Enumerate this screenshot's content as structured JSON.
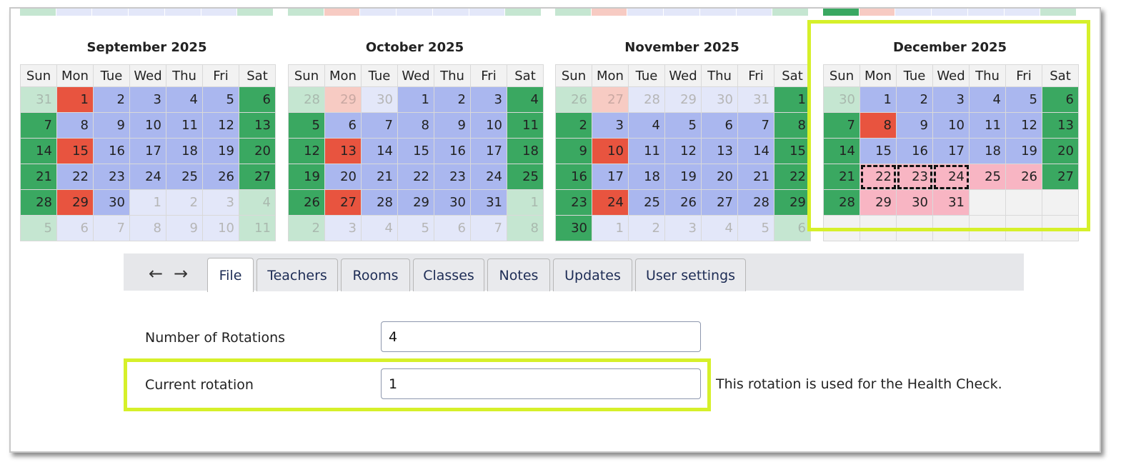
{
  "weekdays": [
    "Sun",
    "Mon",
    "Tue",
    "Wed",
    "Thu",
    "Fri",
    "Sat"
  ],
  "months": [
    {
      "title": "September 2025",
      "prev_strip": [
        "c-lgreen",
        "c-lblue",
        "c-lblue",
        "c-lblue",
        "c-lblue",
        "c-lblue",
        "c-lgreen"
      ],
      "weeks": [
        [
          [
            "31",
            "lgreen"
          ],
          [
            "1",
            "red"
          ],
          [
            "2",
            "blue"
          ],
          [
            "3",
            "blue"
          ],
          [
            "4",
            "blue"
          ],
          [
            "5",
            "blue"
          ],
          [
            "6",
            "green"
          ]
        ],
        [
          [
            "7",
            "green"
          ],
          [
            "8",
            "blue"
          ],
          [
            "9",
            "blue"
          ],
          [
            "10",
            "blue"
          ],
          [
            "11",
            "blue"
          ],
          [
            "12",
            "blue"
          ],
          [
            "13",
            "green"
          ]
        ],
        [
          [
            "14",
            "green"
          ],
          [
            "15",
            "red"
          ],
          [
            "16",
            "blue"
          ],
          [
            "17",
            "blue"
          ],
          [
            "18",
            "blue"
          ],
          [
            "19",
            "blue"
          ],
          [
            "20",
            "green"
          ]
        ],
        [
          [
            "21",
            "green"
          ],
          [
            "22",
            "blue"
          ],
          [
            "23",
            "blue"
          ],
          [
            "24",
            "blue"
          ],
          [
            "25",
            "blue"
          ],
          [
            "26",
            "blue"
          ],
          [
            "27",
            "green"
          ]
        ],
        [
          [
            "28",
            "green"
          ],
          [
            "29",
            "red"
          ],
          [
            "30",
            "blue"
          ],
          [
            "1",
            "lblue"
          ],
          [
            "2",
            "lblue"
          ],
          [
            "3",
            "lblue"
          ],
          [
            "4",
            "lgreen"
          ]
        ],
        [
          [
            "5",
            "lgreen"
          ],
          [
            "6",
            "lblue"
          ],
          [
            "7",
            "lblue"
          ],
          [
            "8",
            "lblue"
          ],
          [
            "9",
            "lblue"
          ],
          [
            "10",
            "lblue"
          ],
          [
            "11",
            "lgreen"
          ]
        ]
      ]
    },
    {
      "title": "October 2025",
      "prev_strip": [
        "c-lgreen",
        "c-lred",
        "c-lblue",
        "c-lblue",
        "c-lblue",
        "c-lblue",
        "c-lgreen"
      ],
      "weeks": [
        [
          [
            "28",
            "lgreen"
          ],
          [
            "29",
            "lred"
          ],
          [
            "30",
            "lblue"
          ],
          [
            "1",
            "blue"
          ],
          [
            "2",
            "blue"
          ],
          [
            "3",
            "blue"
          ],
          [
            "4",
            "green"
          ]
        ],
        [
          [
            "5",
            "green"
          ],
          [
            "6",
            "blue"
          ],
          [
            "7",
            "blue"
          ],
          [
            "8",
            "blue"
          ],
          [
            "9",
            "blue"
          ],
          [
            "10",
            "blue"
          ],
          [
            "11",
            "green"
          ]
        ],
        [
          [
            "12",
            "green"
          ],
          [
            "13",
            "red"
          ],
          [
            "14",
            "blue"
          ],
          [
            "15",
            "blue"
          ],
          [
            "16",
            "blue"
          ],
          [
            "17",
            "blue"
          ],
          [
            "18",
            "green"
          ]
        ],
        [
          [
            "19",
            "green"
          ],
          [
            "20",
            "blue"
          ],
          [
            "21",
            "blue"
          ],
          [
            "22",
            "blue"
          ],
          [
            "23",
            "blue"
          ],
          [
            "24",
            "blue"
          ],
          [
            "25",
            "green"
          ]
        ],
        [
          [
            "26",
            "green"
          ],
          [
            "27",
            "red"
          ],
          [
            "28",
            "blue"
          ],
          [
            "29",
            "blue"
          ],
          [
            "30",
            "blue"
          ],
          [
            "31",
            "blue"
          ],
          [
            "1",
            "lgreen"
          ]
        ],
        [
          [
            "2",
            "lgreen"
          ],
          [
            "3",
            "lblue"
          ],
          [
            "4",
            "lblue"
          ],
          [
            "5",
            "lblue"
          ],
          [
            "6",
            "lblue"
          ],
          [
            "7",
            "lblue"
          ],
          [
            "8",
            "lgreen"
          ]
        ]
      ]
    },
    {
      "title": "November 2025",
      "prev_strip": [
        "c-lgreen",
        "c-lred",
        "c-lblue",
        "c-lblue",
        "c-lblue",
        "c-lblue",
        "c-lgreen"
      ],
      "weeks": [
        [
          [
            "26",
            "lgreen"
          ],
          [
            "27",
            "lred"
          ],
          [
            "28",
            "lblue"
          ],
          [
            "29",
            "lblue"
          ],
          [
            "30",
            "lblue"
          ],
          [
            "31",
            "lblue"
          ],
          [
            "1",
            "green"
          ]
        ],
        [
          [
            "2",
            "green"
          ],
          [
            "3",
            "blue"
          ],
          [
            "4",
            "blue"
          ],
          [
            "5",
            "blue"
          ],
          [
            "6",
            "blue"
          ],
          [
            "7",
            "blue"
          ],
          [
            "8",
            "green"
          ]
        ],
        [
          [
            "9",
            "green"
          ],
          [
            "10",
            "red"
          ],
          [
            "11",
            "blue"
          ],
          [
            "12",
            "blue"
          ],
          [
            "13",
            "blue"
          ],
          [
            "14",
            "blue"
          ],
          [
            "15",
            "green"
          ]
        ],
        [
          [
            "16",
            "green"
          ],
          [
            "17",
            "blue"
          ],
          [
            "18",
            "blue"
          ],
          [
            "19",
            "blue"
          ],
          [
            "20",
            "blue"
          ],
          [
            "21",
            "blue"
          ],
          [
            "22",
            "green"
          ]
        ],
        [
          [
            "23",
            "green"
          ],
          [
            "24",
            "red"
          ],
          [
            "25",
            "blue"
          ],
          [
            "26",
            "blue"
          ],
          [
            "27",
            "blue"
          ],
          [
            "28",
            "blue"
          ],
          [
            "29",
            "green"
          ]
        ],
        [
          [
            "30",
            "green"
          ],
          [
            "1",
            "lblue"
          ],
          [
            "2",
            "lblue"
          ],
          [
            "3",
            "lblue"
          ],
          [
            "4",
            "lblue"
          ],
          [
            "5",
            "lblue"
          ],
          [
            "6",
            "lgreen"
          ]
        ]
      ]
    },
    {
      "title": "December 2025",
      "prev_strip": [
        "c-green",
        "c-lred",
        "c-lblue",
        "c-lblue",
        "c-lblue",
        "c-lblue",
        "c-lgreen"
      ],
      "weeks": [
        [
          [
            "30",
            "lgreen"
          ],
          [
            "1",
            "blue"
          ],
          [
            "2",
            "blue"
          ],
          [
            "3",
            "blue"
          ],
          [
            "4",
            "blue"
          ],
          [
            "5",
            "blue"
          ],
          [
            "6",
            "green"
          ]
        ],
        [
          [
            "7",
            "green"
          ],
          [
            "8",
            "red"
          ],
          [
            "9",
            "blue"
          ],
          [
            "10",
            "blue"
          ],
          [
            "11",
            "blue"
          ],
          [
            "12",
            "blue"
          ],
          [
            "13",
            "green"
          ]
        ],
        [
          [
            "14",
            "green"
          ],
          [
            "15",
            "blue"
          ],
          [
            "16",
            "blue"
          ],
          [
            "17",
            "blue"
          ],
          [
            "18",
            "blue"
          ],
          [
            "19",
            "blue"
          ],
          [
            "20",
            "green"
          ]
        ],
        [
          [
            "21",
            "green"
          ],
          [
            "22",
            "pink dash"
          ],
          [
            "23",
            "pink dash"
          ],
          [
            "24",
            "pink dash"
          ],
          [
            "25",
            "pink"
          ],
          [
            "26",
            "pink"
          ],
          [
            "27",
            "green"
          ]
        ],
        [
          [
            "28",
            "green"
          ],
          [
            "29",
            "pink"
          ],
          [
            "30",
            "pink"
          ],
          [
            "31",
            "pink"
          ],
          [
            "",
            "empty"
          ],
          [
            "",
            "empty"
          ],
          [
            "",
            "empty"
          ]
        ],
        [
          [
            "",
            "empty"
          ],
          [
            "",
            "empty"
          ],
          [
            "",
            "empty"
          ],
          [
            "",
            "empty"
          ],
          [
            "",
            "empty"
          ],
          [
            "",
            "empty"
          ],
          [
            "",
            "empty"
          ]
        ]
      ]
    }
  ],
  "nav": {
    "back": "←",
    "forward": "→"
  },
  "tabs": [
    "File",
    "Teachers",
    "Rooms",
    "Classes",
    "Notes",
    "Updates",
    "User settings"
  ],
  "form": {
    "rotations_label": "Number of Rotations",
    "rotations_value": "4",
    "current_label": "Current rotation",
    "current_value": "1",
    "current_note": "This rotation is used for the Health Check."
  },
  "colors": {
    "highlight": "#d6f02a",
    "workday": "#aab7ef",
    "weekend": "#3aa861",
    "rotation_day": "#e8543f",
    "holiday": "#f8b5c3"
  }
}
